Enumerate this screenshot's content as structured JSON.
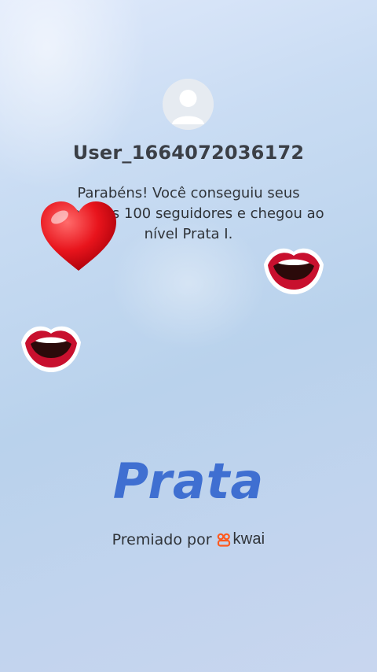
{
  "profile": {
    "username": "User_1664072036172",
    "avatar_icon": "user-avatar-icon"
  },
  "message": {
    "text": "Parabéns! Você conseguiu seus primeiros 100 seguidores e chegou ao nível Prata I."
  },
  "level": {
    "title": "Prata",
    "color": "#3f6fd1"
  },
  "footer": {
    "awarded_by_label": "Premiado por",
    "brand_name": "kwai",
    "brand_color": "#ff5a1f"
  },
  "decorations": {
    "icons": [
      "heart-emoji-icon",
      "lips-emoji-icon",
      "lips-emoji-icon"
    ]
  }
}
